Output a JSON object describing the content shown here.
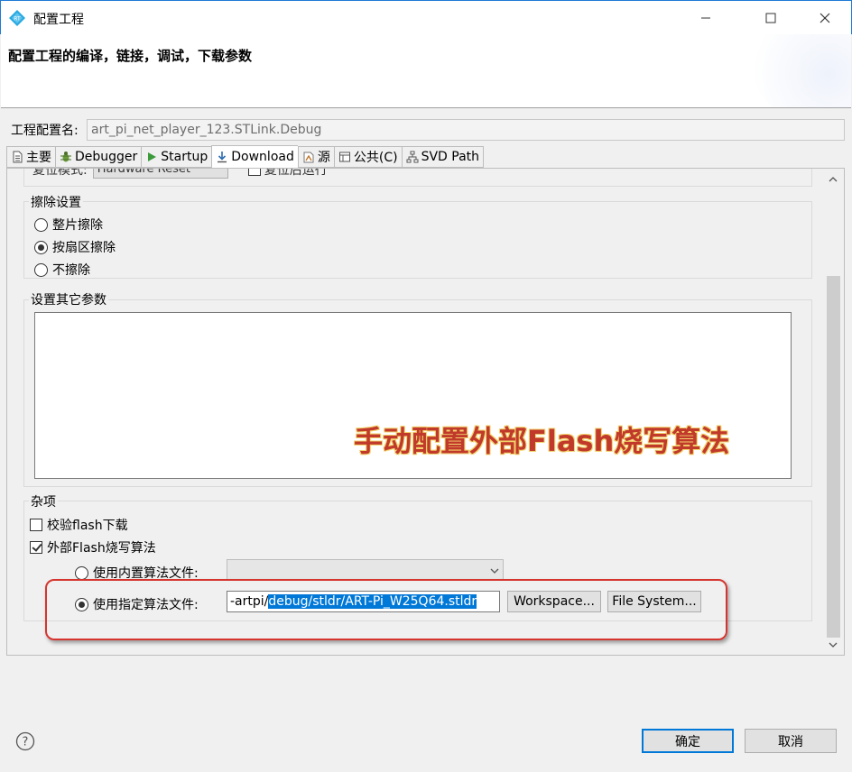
{
  "window": {
    "title": "配置工程"
  },
  "header": {
    "heading": "配置工程的编译，链接，调试，下载参数"
  },
  "config": {
    "label": "工程配置名:",
    "value": "art_pi_net_player_123.STLink.Debug"
  },
  "tabs": [
    {
      "label": "主要",
      "icon": "document-icon"
    },
    {
      "label": "Debugger",
      "icon": "bug-icon"
    },
    {
      "label": "Startup",
      "icon": "play-icon"
    },
    {
      "label": "Download",
      "icon": "download-icon",
      "active": true
    },
    {
      "label": "源",
      "icon": "source-icon"
    },
    {
      "label": "公共(C)",
      "icon": "common-icon"
    },
    {
      "label": "SVD Path",
      "icon": "svd-icon"
    }
  ],
  "top_partial": {
    "label": "复位模式:",
    "value": "Hardware Reset",
    "check_label": "复位后运行"
  },
  "erase": {
    "title": "擦除设置",
    "options": [
      "整片擦除",
      "按扇区擦除",
      "不擦除"
    ],
    "selected": 1
  },
  "other_params": {
    "title": "设置其它参数"
  },
  "overlay": {
    "text": "手动配置外部Flash烧写算法"
  },
  "misc": {
    "title": "杂项",
    "verify_label": "校验flash下载",
    "external_label": "外部Flash烧写算法",
    "builtin_label": "使用内置算法文件:",
    "custom_label": "使用指定算法文件:",
    "path_prefix": "-artpi/",
    "path_selected": "debug/stldr/ART-Pi_W25Q64.stldr",
    "workspace_label": "Workspace...",
    "filesystem_label": "File System..."
  },
  "buttons": {
    "ok": "确定",
    "cancel": "取消"
  },
  "colors": {
    "accent": "#0078d7",
    "highlight": "#d6352f"
  }
}
